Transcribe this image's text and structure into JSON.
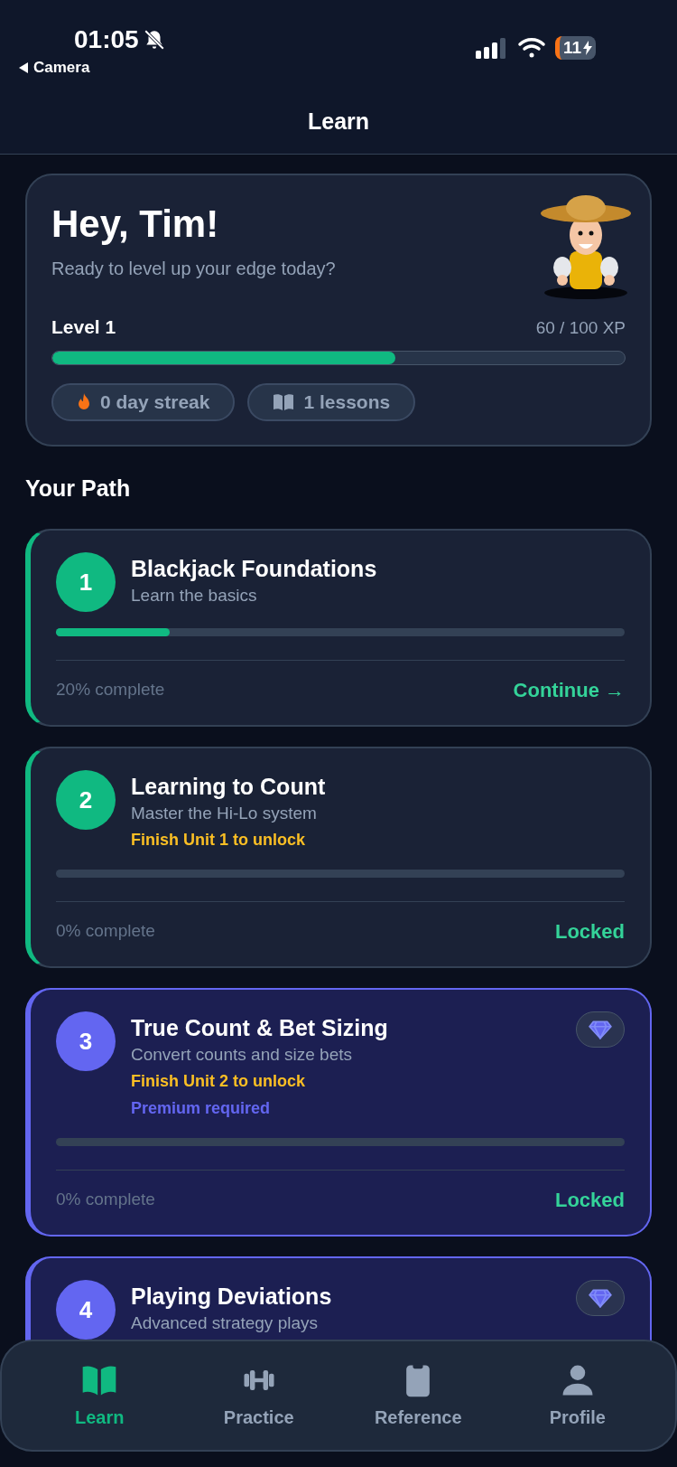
{
  "status_bar": {
    "time": "01:05",
    "back_label": "Camera",
    "battery": "11"
  },
  "header": {
    "title": "Learn"
  },
  "hero": {
    "greeting": "Hey, Tim!",
    "subtitle": "Ready to level up your edge today?",
    "level_label": "Level 1",
    "xp": "60 / 100 XP",
    "level": 0.6,
    "chips": [
      {
        "kind": "streak",
        "label": "0 day streak"
      },
      {
        "kind": "lessons",
        "label": "1 lessons"
      }
    ]
  },
  "path": {
    "title": "Your Path",
    "units": [
      {
        "kind": "standard",
        "number": "1",
        "title": "Blackjack Foundations",
        "subtitle": "Learn the basics",
        "level": 0.2,
        "progress_text": "20% complete",
        "action": "Continue →"
      },
      {
        "kind": "standard",
        "number": "2",
        "title": "Learning to Count",
        "subtitle": "Master the Hi-Lo system",
        "lock_note": "Finish Unit 1 to unlock",
        "level": 0,
        "progress_text": "0% complete",
        "action": "Locked"
      },
      {
        "kind": "premium",
        "number": "3",
        "title": "True Count & Bet Sizing",
        "subtitle": "Convert counts and size bets",
        "lock_note": "Finish Unit 2 to unlock",
        "premium_note": "Premium required",
        "level": 0,
        "progress_text": "0% complete",
        "action": "Locked"
      },
      {
        "kind": "premium",
        "number": "4",
        "title": "Playing Deviations",
        "subtitle": "Advanced strategy plays"
      }
    ]
  },
  "tab_bar": [
    {
      "kind": "learn",
      "label": "Learn",
      "selected": true
    },
    {
      "kind": "practice",
      "label": "Practice",
      "selected": false
    },
    {
      "kind": "reference",
      "label": "Reference",
      "selected": false
    },
    {
      "kind": "profile",
      "label": "Profile",
      "selected": false
    }
  ]
}
